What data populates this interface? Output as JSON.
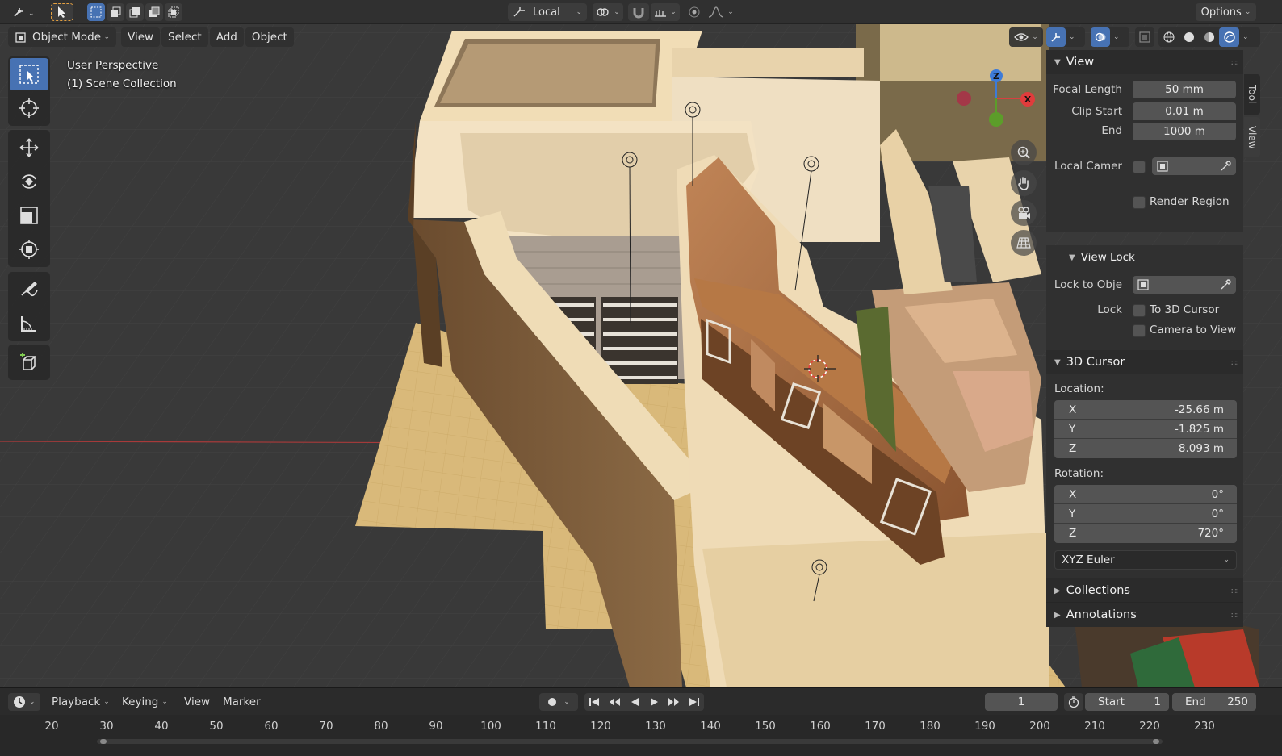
{
  "header": {
    "orientation_label": "Local",
    "options_label": "Options"
  },
  "viewport": {
    "mode_label": "Object Mode",
    "menus": [
      "View",
      "Select",
      "Add",
      "Object"
    ],
    "perspective": "User Perspective",
    "collection": "(1) Scene Collection",
    "gizmo": {
      "x": "X",
      "z": "Z"
    }
  },
  "sidebar": {
    "tabs": [
      "Tool",
      "View"
    ],
    "view_panel": {
      "title": "View",
      "focal_length_label": "Focal Length",
      "focal_length": "50 mm",
      "clip_start_label": "Clip Start",
      "clip_start": "0.01 m",
      "clip_end_label": "End",
      "clip_end": "1000 m",
      "local_camera_label": "Local Camer",
      "render_region_label": "Render Region"
    },
    "view_lock": {
      "title": "View Lock",
      "lock_to_object_label": "Lock to Obje",
      "lock_label": "Lock",
      "to_3d_cursor_label": "To 3D Cursor",
      "camera_to_view_label": "Camera to View"
    },
    "cursor_panel": {
      "title": "3D Cursor",
      "location_label": "Location:",
      "location": [
        {
          "axis": "X",
          "value": "-25.66 m"
        },
        {
          "axis": "Y",
          "value": "-1.825 m"
        },
        {
          "axis": "Z",
          "value": "8.093 m"
        }
      ],
      "rotation_label": "Rotation:",
      "rotation": [
        {
          "axis": "X",
          "value": "0°"
        },
        {
          "axis": "Y",
          "value": "0°"
        },
        {
          "axis": "Z",
          "value": "720°"
        }
      ],
      "rotation_mode": "XYZ Euler"
    },
    "collections_title": "Collections",
    "annotations_title": "Annotations"
  },
  "timeline": {
    "menus": [
      "Playback",
      "Keying",
      "View",
      "Marker"
    ],
    "current_frame": "1",
    "start_label": "Start",
    "start_value": "1",
    "end_label": "End",
    "end_value": "250",
    "ruler": [
      "20",
      "30",
      "40",
      "50",
      "60",
      "70",
      "80",
      "90",
      "100",
      "110",
      "120",
      "130",
      "140",
      "150",
      "160",
      "170",
      "180",
      "190",
      "200",
      "210",
      "220",
      "230"
    ]
  },
  "colors": {
    "accent": "#4772b3",
    "panel_bg": "#303030",
    "field_bg": "#545454",
    "wall_light": "#efdcb6",
    "wall_dark": "#6b4f33",
    "floor": "#d9b97a",
    "wood": "#a86c3e"
  }
}
